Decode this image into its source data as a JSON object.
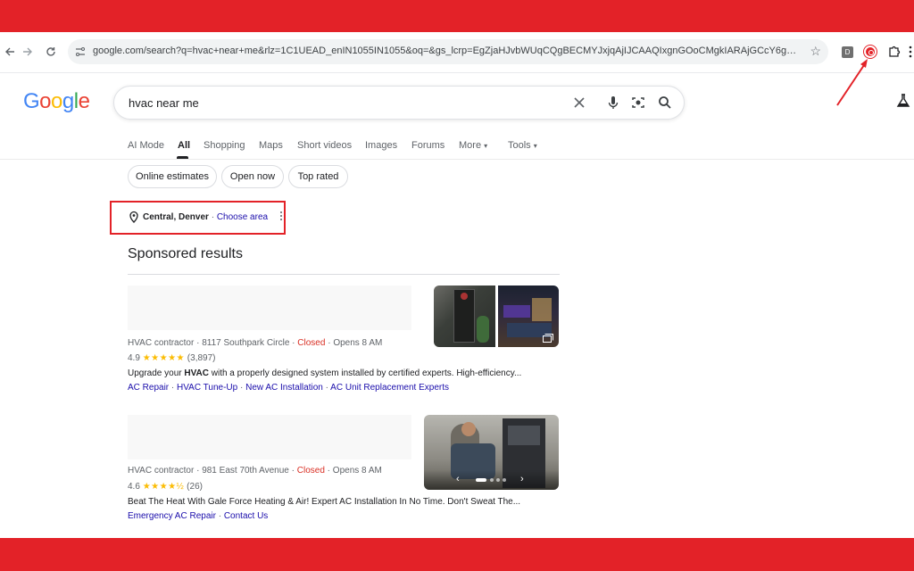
{
  "browser": {
    "url": "google.com/search?q=hvac+near+me&rlz=1C1UEAD_enIN1055IN1055&oq=&gs_lcrp=EgZjaHJvbWUqCQgBECMYJxjqAjIJCAAQIxgnGOoCMgkIARAjGCcY6glyCQgCECMYJx...",
    "ext_d_label": "D"
  },
  "search": {
    "logo": "Google",
    "query": "hvac near me"
  },
  "tabs": [
    {
      "label": "AI Mode"
    },
    {
      "label": "All"
    },
    {
      "label": "Shopping"
    },
    {
      "label": "Maps"
    },
    {
      "label": "Short videos"
    },
    {
      "label": "Images"
    },
    {
      "label": "Forums"
    },
    {
      "label": "More"
    },
    {
      "label": "Tools"
    }
  ],
  "chips": [
    {
      "label": "Online estimates"
    },
    {
      "label": "Open now"
    },
    {
      "label": "Top rated"
    }
  ],
  "location": {
    "city": "Central, Denver",
    "separator": " · ",
    "link": "Choose area"
  },
  "sponsored": {
    "heading": "Sponsored results",
    "results": [
      {
        "category": "HVAC contractor",
        "address": "8117 Southpark Circle",
        "status": "Closed",
        "opens": "Opens 8 AM",
        "rating": "4.9",
        "stars": "★★★★★",
        "reviews": "(3,897)",
        "desc_pre": "Upgrade your ",
        "desc_bold": "HVAC",
        "desc_post": " with a properly designed system installed by certified experts. High-efficiency...",
        "links": [
          "AC Repair",
          "HVAC Tune-Up",
          "New AC Installation",
          "AC Unit Replacement Experts"
        ]
      },
      {
        "category": "HVAC contractor",
        "address": "981 East 70th Avenue",
        "status": "Closed",
        "opens": "Opens 8 AM",
        "rating": "4.6",
        "stars": "★★★★½",
        "reviews": "(26)",
        "desc": "Beat The Heat With Gale Force Heating & Air! Expert AC Installation In No Time. Don't Sweat The...",
        "links": [
          "Emergency AC Repair",
          "Contact Us"
        ]
      }
    ]
  },
  "colors": {
    "frame_red": "#e32228",
    "link_blue": "#1a0dab",
    "closed_red": "#d93025",
    "star_yellow": "#fbbc04"
  }
}
